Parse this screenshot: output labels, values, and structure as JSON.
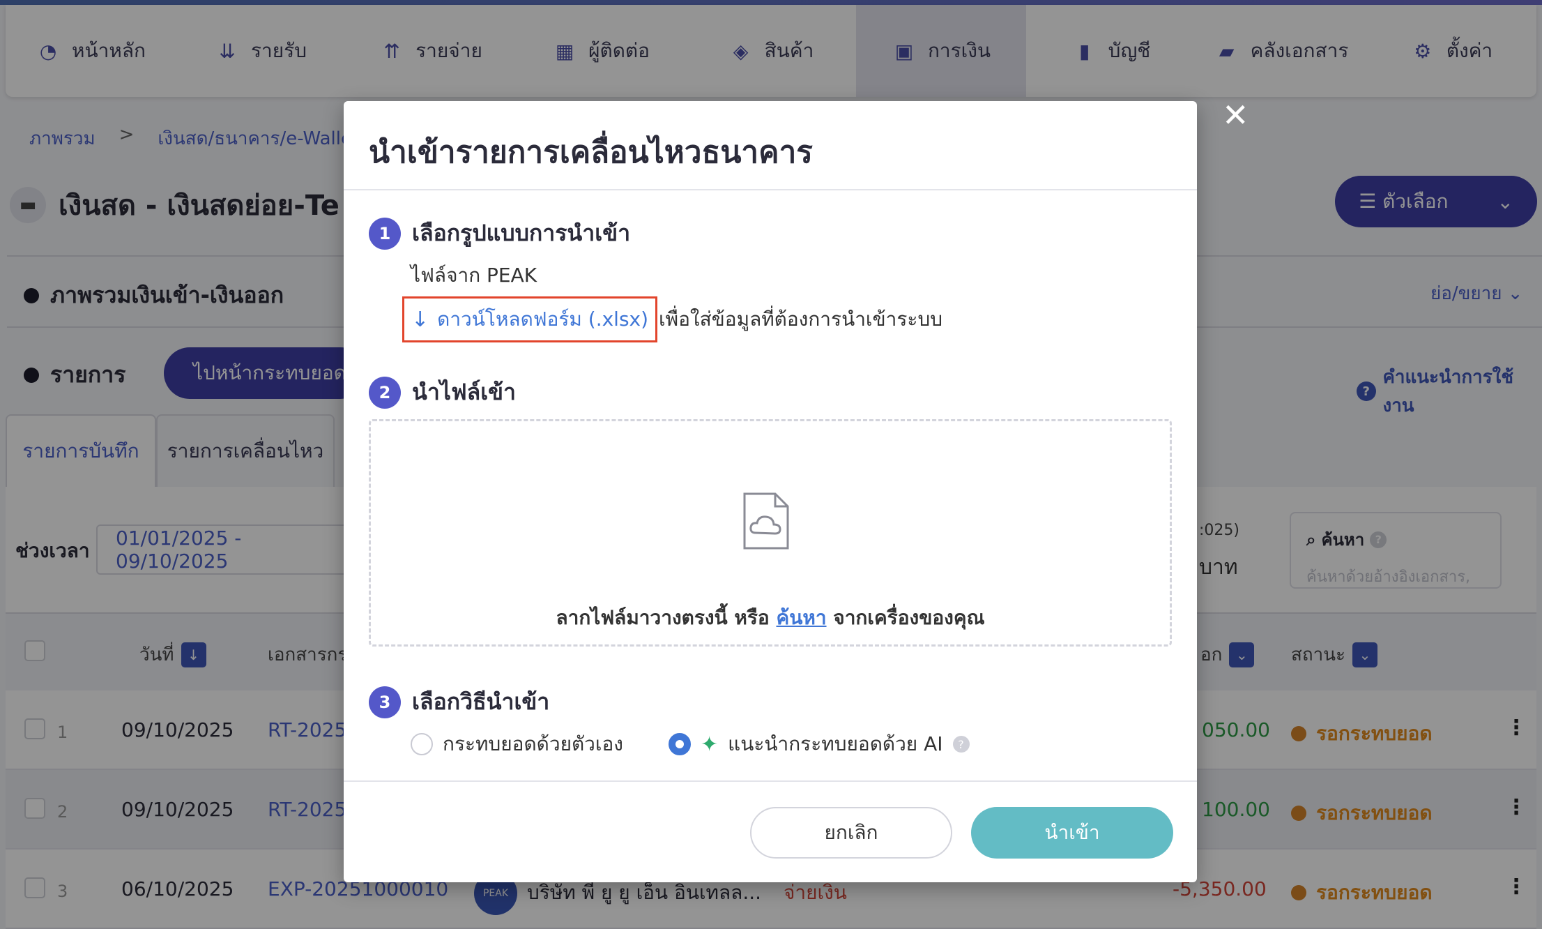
{
  "nav": {
    "items": [
      {
        "label": "หน้าหลัก",
        "icon": "dashboard-icon",
        "glyph": "◔"
      },
      {
        "label": "รายรับ",
        "icon": "income-icon",
        "glyph": "⇊"
      },
      {
        "label": "รายจ่าย",
        "icon": "expense-icon",
        "glyph": "⇈"
      },
      {
        "label": "ผู้ติดต่อ",
        "icon": "contacts-icon",
        "glyph": "▦"
      },
      {
        "label": "สินค้า",
        "icon": "product-box-icon",
        "glyph": "◈"
      },
      {
        "label": "การเงิน",
        "icon": "money-icon",
        "glyph": "▣"
      },
      {
        "label": "บัญชี",
        "icon": "ledger-book-icon",
        "glyph": "▮"
      },
      {
        "label": "คลังเอกสาร",
        "icon": "folder-icon",
        "glyph": "▰"
      },
      {
        "label": "ตั้งค่า",
        "icon": "gear-icon",
        "glyph": "⚙"
      }
    ]
  },
  "breadcrumb": {
    "home": "ภาพรวม",
    "sep": ">",
    "current": "เงินสด/ธนาคาร/e-Walle"
  },
  "page": {
    "title": "เงินสด - เงินสดย่อย-Te",
    "options_label": "☰ ตัวเลือก",
    "overview_heading": "ภาพรวมเงินเข้า-เงินออก",
    "collapse_label": "ย่อ/ขยาย",
    "list_heading": "รายการ",
    "reconcile_button": "ไปหน้ากระทบยอด",
    "help_label": "คำแนะนำการใช้งาน"
  },
  "tabs": {
    "recorded": "รายการบันทึก",
    "movements": "รายการเคลื่อนไหว"
  },
  "filter": {
    "range_label": "ช่วงเวลา",
    "range_value": "01/01/2025 - 09/10/2025",
    "partial_top": ":025)",
    "partial_unit": "บาท",
    "search_title": "ค้นหา",
    "search_placeholder": "ค้นหาด้วยอ้างอิงเอกสาร,"
  },
  "table": {
    "headers": {
      "date": "วันที่",
      "doc": "เอกสารกร",
      "out": "อก",
      "status": "สถานะ"
    },
    "rows": [
      {
        "num": "1",
        "date": "09/10/2025",
        "doc": "RT-2025",
        "amount": "050.00",
        "status": "รอกระทบยอด"
      },
      {
        "num": "2",
        "date": "09/10/2025",
        "doc": "RT-2025",
        "amount": "100.00",
        "status": "รอกระทบยอด"
      },
      {
        "num": "3",
        "date": "06/10/2025",
        "doc": "EXP-20251000010",
        "party": "บริษัท พี ยู ยู เอ็น อินเทลล...",
        "type": "จ่ายเงิน",
        "amount": "-5,350.00",
        "status": "รอกระทบยอด"
      }
    ]
  },
  "modal": {
    "title": "นำเข้ารายการเคลื่อนไหวธนาคาร",
    "close_glyph": "✕",
    "step1": {
      "num": "1",
      "label": "เลือกรูปแบบการนำเข้า",
      "source": "ไฟล์จาก PEAK",
      "download_label": "ดาวน์โหลดฟอร์ม (.xlsx)",
      "download_note": "เพื่อใส่ข้อมูลที่ต้องการนำเข้าระบบ"
    },
    "step2": {
      "num": "2",
      "label": "นำไฟล์เข้า",
      "drop_before": "ลากไฟล์มาวางตรงนี้ หรือ ",
      "drop_link": "ค้นหา",
      "drop_after": " จากเครื่องของคุณ"
    },
    "step3": {
      "num": "3",
      "label": "เลือกวิธีนำเข้า",
      "manual_option": "กระทบยอดด้วยตัวเอง",
      "ai_option": "แนะนำกระทบยอดด้วย AI",
      "selected": "ai"
    },
    "cancel_label": "ยกเลิก",
    "import_label": "นำเข้า"
  },
  "colors": {
    "brand": "#3f3fa6",
    "link": "#3f76d6",
    "highlight_box": "#e2452c",
    "import_button": "#63bcc5",
    "pending": "#e08a1e"
  }
}
